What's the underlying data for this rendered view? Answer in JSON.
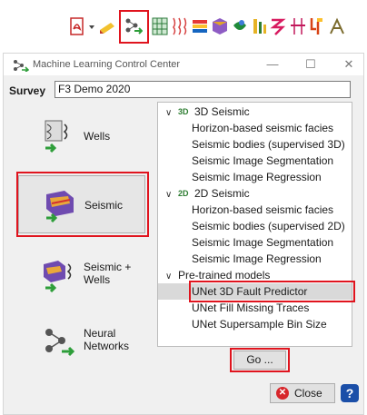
{
  "toolbar": {
    "icons": [
      "pdf-export-icon",
      "dropdown-arrow-icon",
      "pencil-icon",
      "machine-learning-icon",
      "grid-icon",
      "well-logs-icon",
      "horizons-icon",
      "surfaces-icon",
      "bodies-icon",
      "crossplot-icon",
      "attributes-icon",
      "log-tools-icon",
      "volumes-icon",
      "analysis-icon"
    ]
  },
  "window": {
    "title": "Machine Learning Control Center",
    "minimize": "—",
    "maximize": "☐",
    "close": "✕"
  },
  "survey": {
    "label": "Survey",
    "value": "F3 Demo 2020"
  },
  "categories": [
    {
      "label_line1": "Wells",
      "label_line2": ""
    },
    {
      "label_line1": "Seismic",
      "label_line2": ""
    },
    {
      "label_line1": "Seismic +",
      "label_line2": "Wells"
    },
    {
      "label_line1": "Neural",
      "label_line2": "Networks"
    }
  ],
  "tree": {
    "group_3d": "3D Seismic",
    "items_3d": [
      "Horizon-based seismic facies",
      "Seismic bodies (supervised 3D)",
      "Seismic Image Segmentation",
      "Seismic Image Regression"
    ],
    "group_2d": "2D Seismic",
    "items_2d": [
      "Horizon-based seismic facies",
      "Seismic bodies (supervised 2D)",
      "Seismic Image Segmentation",
      "Seismic Image Regression"
    ],
    "group_pretrained": "Pre-trained models",
    "items_pretrained": [
      "UNet 3D Fault Predictor",
      "UNet Fill Missing Traces",
      "UNet Supersample Bin Size"
    ],
    "selected": "UNet 3D Fault Predictor"
  },
  "buttons": {
    "go": "Go ...",
    "close": "Close",
    "help": "?"
  },
  "colors": {
    "highlight": "#e0141e",
    "selection": "#d9d9d9",
    "close_icon": "#d7262b",
    "help_icon": "#1b4fa8"
  }
}
